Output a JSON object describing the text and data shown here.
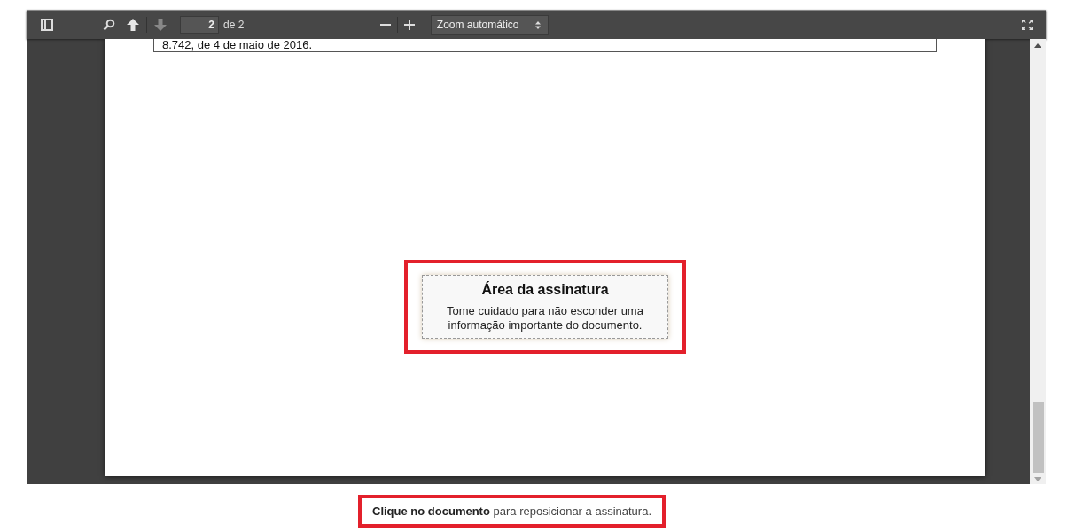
{
  "toolbar": {
    "page_up": {
      "disabled": false
    },
    "page_down": {
      "disabled": true
    },
    "page_number": "2",
    "page_count": "de 2",
    "zoom": "Zoom automático"
  },
  "document": {
    "text_line": "8.742, de 4 de maio de 2016.",
    "signature": {
      "title": "Área da assinatura",
      "hint": "Tome cuidado para não esconder uma informação importante do documento.",
      "highlighted": true
    }
  },
  "caption": {
    "text": "**Clique no documento** para reposicionar a assinatura.",
    "highlighted": true
  }
}
